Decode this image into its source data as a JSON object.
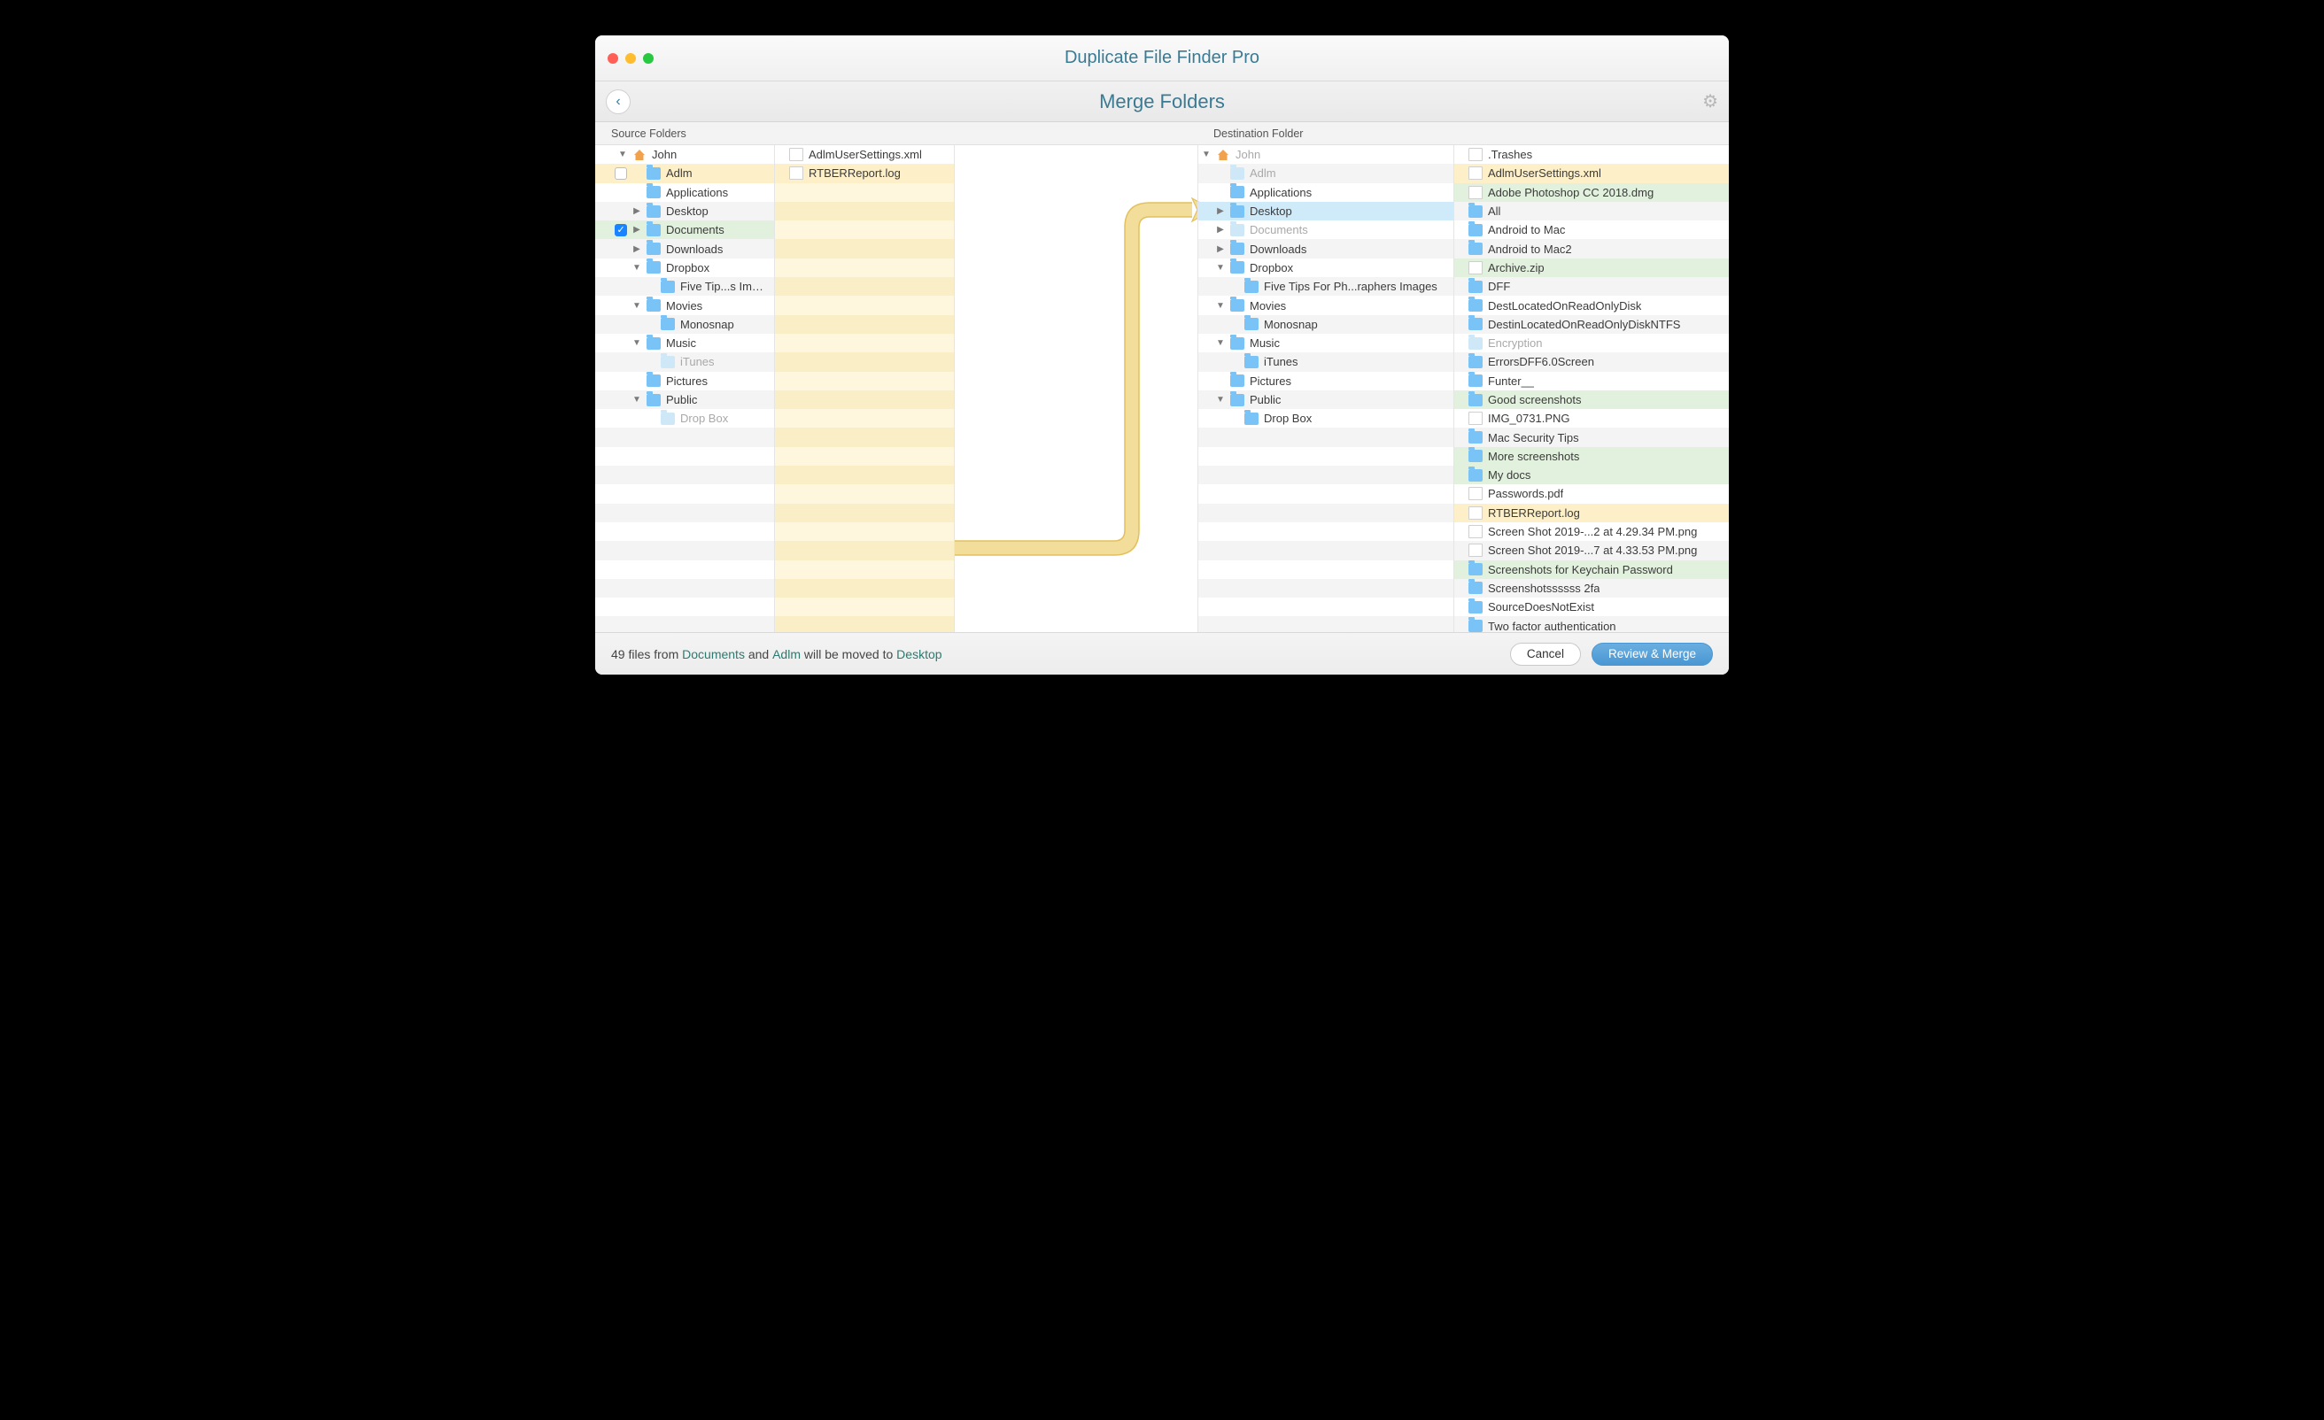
{
  "window": {
    "title": "Duplicate File Finder Pro"
  },
  "toolbar": {
    "subtitle": "Merge Folders"
  },
  "labels": {
    "source": "Source Folders",
    "destination": "Destination Folder"
  },
  "sourceTree": [
    {
      "label": "John",
      "d": 0,
      "tri": "down",
      "icon": "home",
      "chk": "none"
    },
    {
      "label": "Adlm",
      "d": 1,
      "tri": "none",
      "icon": "folder",
      "chk": "empty",
      "hl": "yellow"
    },
    {
      "label": "Applications",
      "d": 1,
      "tri": "none",
      "icon": "folder"
    },
    {
      "label": "Desktop",
      "d": 1,
      "tri": "right",
      "icon": "folder"
    },
    {
      "label": "Documents",
      "d": 1,
      "tri": "right",
      "icon": "folder",
      "chk": "checked",
      "hl": "green"
    },
    {
      "label": "Downloads",
      "d": 1,
      "tri": "right",
      "icon": "folder"
    },
    {
      "label": "Dropbox",
      "d": 1,
      "tri": "down",
      "icon": "folder"
    },
    {
      "label": "Five Tip...s Images",
      "d": 2,
      "tri": "none",
      "icon": "folder"
    },
    {
      "label": "Movies",
      "d": 1,
      "tri": "down",
      "icon": "folder"
    },
    {
      "label": "Monosnap",
      "d": 2,
      "tri": "none",
      "icon": "folder"
    },
    {
      "label": "Music",
      "d": 1,
      "tri": "down",
      "icon": "folder"
    },
    {
      "label": "iTunes",
      "d": 2,
      "tri": "none",
      "icon": "folderdim",
      "dim": true
    },
    {
      "label": "Pictures",
      "d": 1,
      "tri": "none",
      "icon": "folder"
    },
    {
      "label": "Public",
      "d": 1,
      "tri": "down",
      "icon": "folder"
    },
    {
      "label": "Drop Box",
      "d": 2,
      "tri": "none",
      "icon": "folderdim",
      "dim": true
    }
  ],
  "sourceFiles": [
    {
      "label": "AdlmUserSettings.xml",
      "icon": "file"
    },
    {
      "label": "RTBERReport.log",
      "icon": "file",
      "hl": "yellow"
    }
  ],
  "destTree": [
    {
      "label": "John",
      "d": 0,
      "tri": "down",
      "icon": "home",
      "dim": true
    },
    {
      "label": "Adlm",
      "d": 1,
      "tri": "none",
      "icon": "folderdim",
      "dim": true
    },
    {
      "label": "Applications",
      "d": 1,
      "tri": "none",
      "icon": "folder"
    },
    {
      "label": "Desktop",
      "d": 1,
      "tri": "right",
      "icon": "folder",
      "hl": "blue"
    },
    {
      "label": "Documents",
      "d": 1,
      "tri": "right",
      "icon": "folderdim",
      "dim": true
    },
    {
      "label": "Downloads",
      "d": 1,
      "tri": "right",
      "icon": "folder"
    },
    {
      "label": "Dropbox",
      "d": 1,
      "tri": "down",
      "icon": "folder"
    },
    {
      "label": "Five Tips For Ph...raphers Images",
      "d": 2,
      "tri": "none",
      "icon": "folder"
    },
    {
      "label": "Movies",
      "d": 1,
      "tri": "down",
      "icon": "folder"
    },
    {
      "label": "Monosnap",
      "d": 2,
      "tri": "none",
      "icon": "folder"
    },
    {
      "label": "Music",
      "d": 1,
      "tri": "down",
      "icon": "folder"
    },
    {
      "label": "iTunes",
      "d": 2,
      "tri": "none",
      "icon": "folder"
    },
    {
      "label": "Pictures",
      "d": 1,
      "tri": "none",
      "icon": "folder"
    },
    {
      "label": "Public",
      "d": 1,
      "tri": "down",
      "icon": "folder"
    },
    {
      "label": "Drop Box",
      "d": 2,
      "tri": "none",
      "icon": "folder"
    }
  ],
  "destFiles": [
    {
      "label": ".Trashes",
      "icon": "file"
    },
    {
      "label": "AdlmUserSettings.xml",
      "icon": "file",
      "hl": "yellow"
    },
    {
      "label": "Adobe Photoshop CC 2018.dmg",
      "icon": "file",
      "hl": "green"
    },
    {
      "label": "All",
      "icon": "folder"
    },
    {
      "label": "Android to Mac",
      "icon": "folder"
    },
    {
      "label": "Android to Mac2",
      "icon": "folder"
    },
    {
      "label": "Archive.zip",
      "icon": "file",
      "hl": "green"
    },
    {
      "label": "DFF",
      "icon": "folder"
    },
    {
      "label": "DestLocatedOnReadOnlyDisk",
      "icon": "folder"
    },
    {
      "label": "DestinLocatedOnReadOnlyDiskNTFS",
      "icon": "folder"
    },
    {
      "label": "Encryption",
      "icon": "folderdim",
      "dim": true
    },
    {
      "label": "ErrorsDFF6.0Screen",
      "icon": "folder"
    },
    {
      "label": "Funter__",
      "icon": "folder"
    },
    {
      "label": "Good screenshots",
      "icon": "folder",
      "hl": "green"
    },
    {
      "label": "IMG_0731.PNG",
      "icon": "file"
    },
    {
      "label": "Mac Security Tips",
      "icon": "folder"
    },
    {
      "label": "More screenshots",
      "icon": "folder",
      "hl": "green"
    },
    {
      "label": "My docs",
      "icon": "folder",
      "hl": "green"
    },
    {
      "label": "Passwords.pdf",
      "icon": "file"
    },
    {
      "label": "RTBERReport.log",
      "icon": "file",
      "hl": "yellow"
    },
    {
      "label": "Screen Shot 2019-...2 at 4.29.34 PM.png",
      "icon": "file"
    },
    {
      "label": "Screen Shot 2019-...7 at 4.33.53 PM.png",
      "icon": "file"
    },
    {
      "label": "Screenshots for Keychain Password",
      "icon": "folder",
      "hl": "green"
    },
    {
      "label": "Screenshotssssss 2fa",
      "icon": "folder"
    },
    {
      "label": "SourceDoesNotExist",
      "icon": "folder"
    },
    {
      "label": "Two factor authentication",
      "icon": "folder"
    }
  ],
  "footer": {
    "status_pre": "49 files from ",
    "status_src1": "Documents",
    "status_mid": " and ",
    "status_src2": "Adlm",
    "status_post": " will be moved to ",
    "status_dest": "Desktop",
    "cancel": "Cancel",
    "review": "Review & Merge"
  }
}
